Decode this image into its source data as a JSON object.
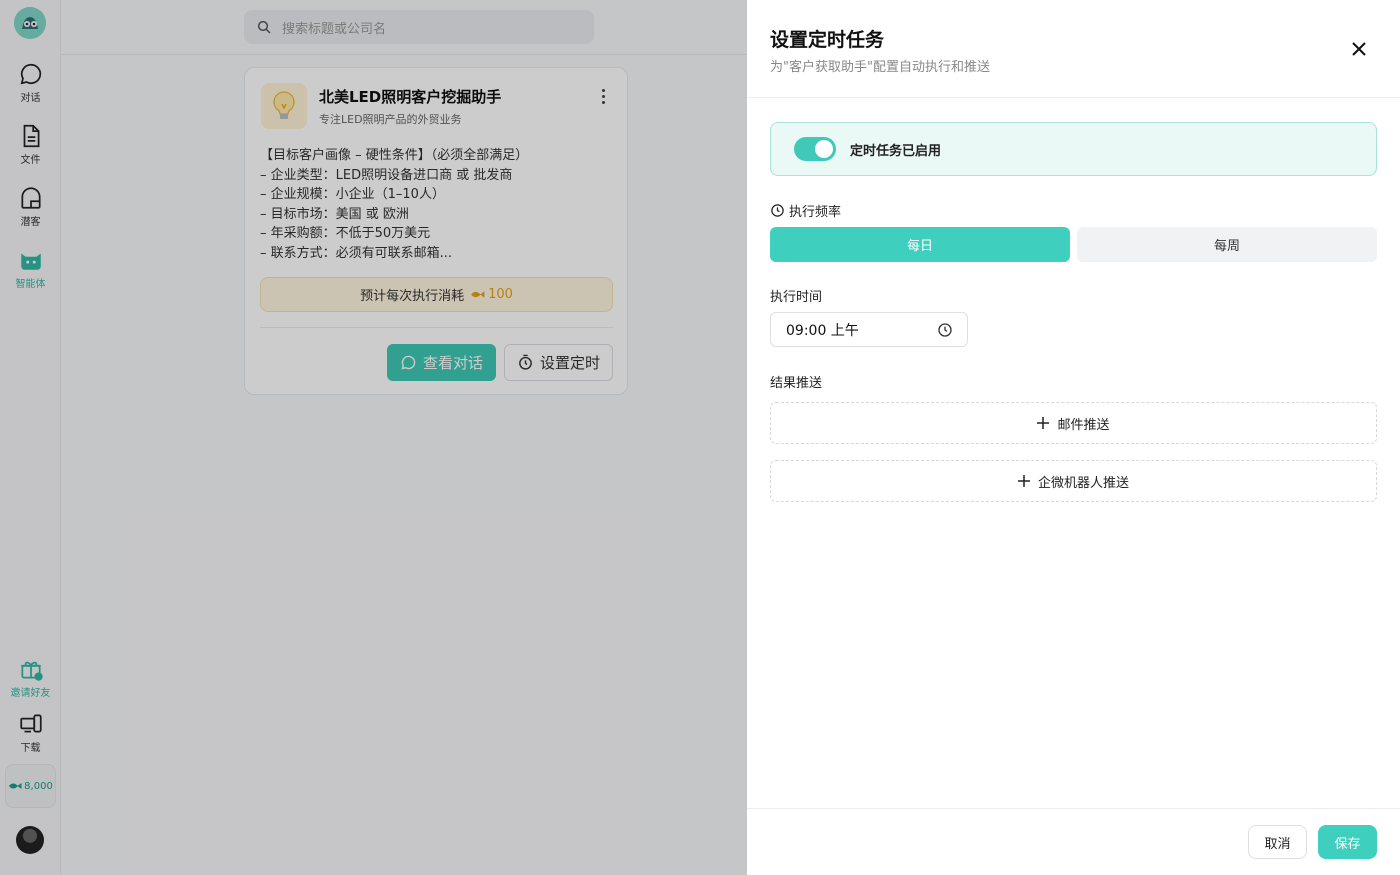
{
  "sidebar": {
    "items": [
      {
        "label": "对话",
        "icon": "chat-icon"
      },
      {
        "label": "文件",
        "icon": "file-icon"
      },
      {
        "label": "潜客",
        "icon": "prospect-icon"
      },
      {
        "label": "智能体",
        "icon": "agent-icon",
        "active": true
      }
    ],
    "bottom_items": [
      {
        "label": "邀请好友",
        "icon": "gift-icon"
      },
      {
        "label": "下载",
        "icon": "devices-icon"
      }
    ],
    "points": "8,000"
  },
  "search": {
    "placeholder": "搜索标题或公司名"
  },
  "card": {
    "title": "北美LED照明客户挖掘助手",
    "subtitle": "专注LED照明产品的外贸业务",
    "description": [
      "【目标客户画像 – 硬性条件】（必须全部满足）",
      "– 企业类型：LED照明设备进口商 或 批发商",
      "– 企业规模：小企业（1–10人）",
      "– 目标市场：美国 或 欧洲",
      "– 年采购额：不低于50万美元",
      "– 联系方式：必须有可联系邮箱..."
    ],
    "cost_label": "预计每次执行消耗",
    "cost_value": "100",
    "view_button": "查看对话",
    "schedule_button": "设置定时"
  },
  "drawer": {
    "title": "设置定时任务",
    "subtitle": "为\"客户获取助手\"配置自动执行和推送",
    "enabled_label": "定时任务已启用",
    "enabled": true,
    "frequency_label": "执行频率",
    "frequency_options": [
      "每日",
      "每周"
    ],
    "frequency_selected": "每日",
    "time_label": "执行时间",
    "time_value": "09:00 上午",
    "push_label": "结果推送",
    "push_email": "邮件推送",
    "push_wecom": "企微机器人推送",
    "cancel": "取消",
    "save": "保存"
  },
  "colors": {
    "accent": "#3fcfbf",
    "accent_dark": "#2fb7a5",
    "coin": "#e6a317"
  }
}
